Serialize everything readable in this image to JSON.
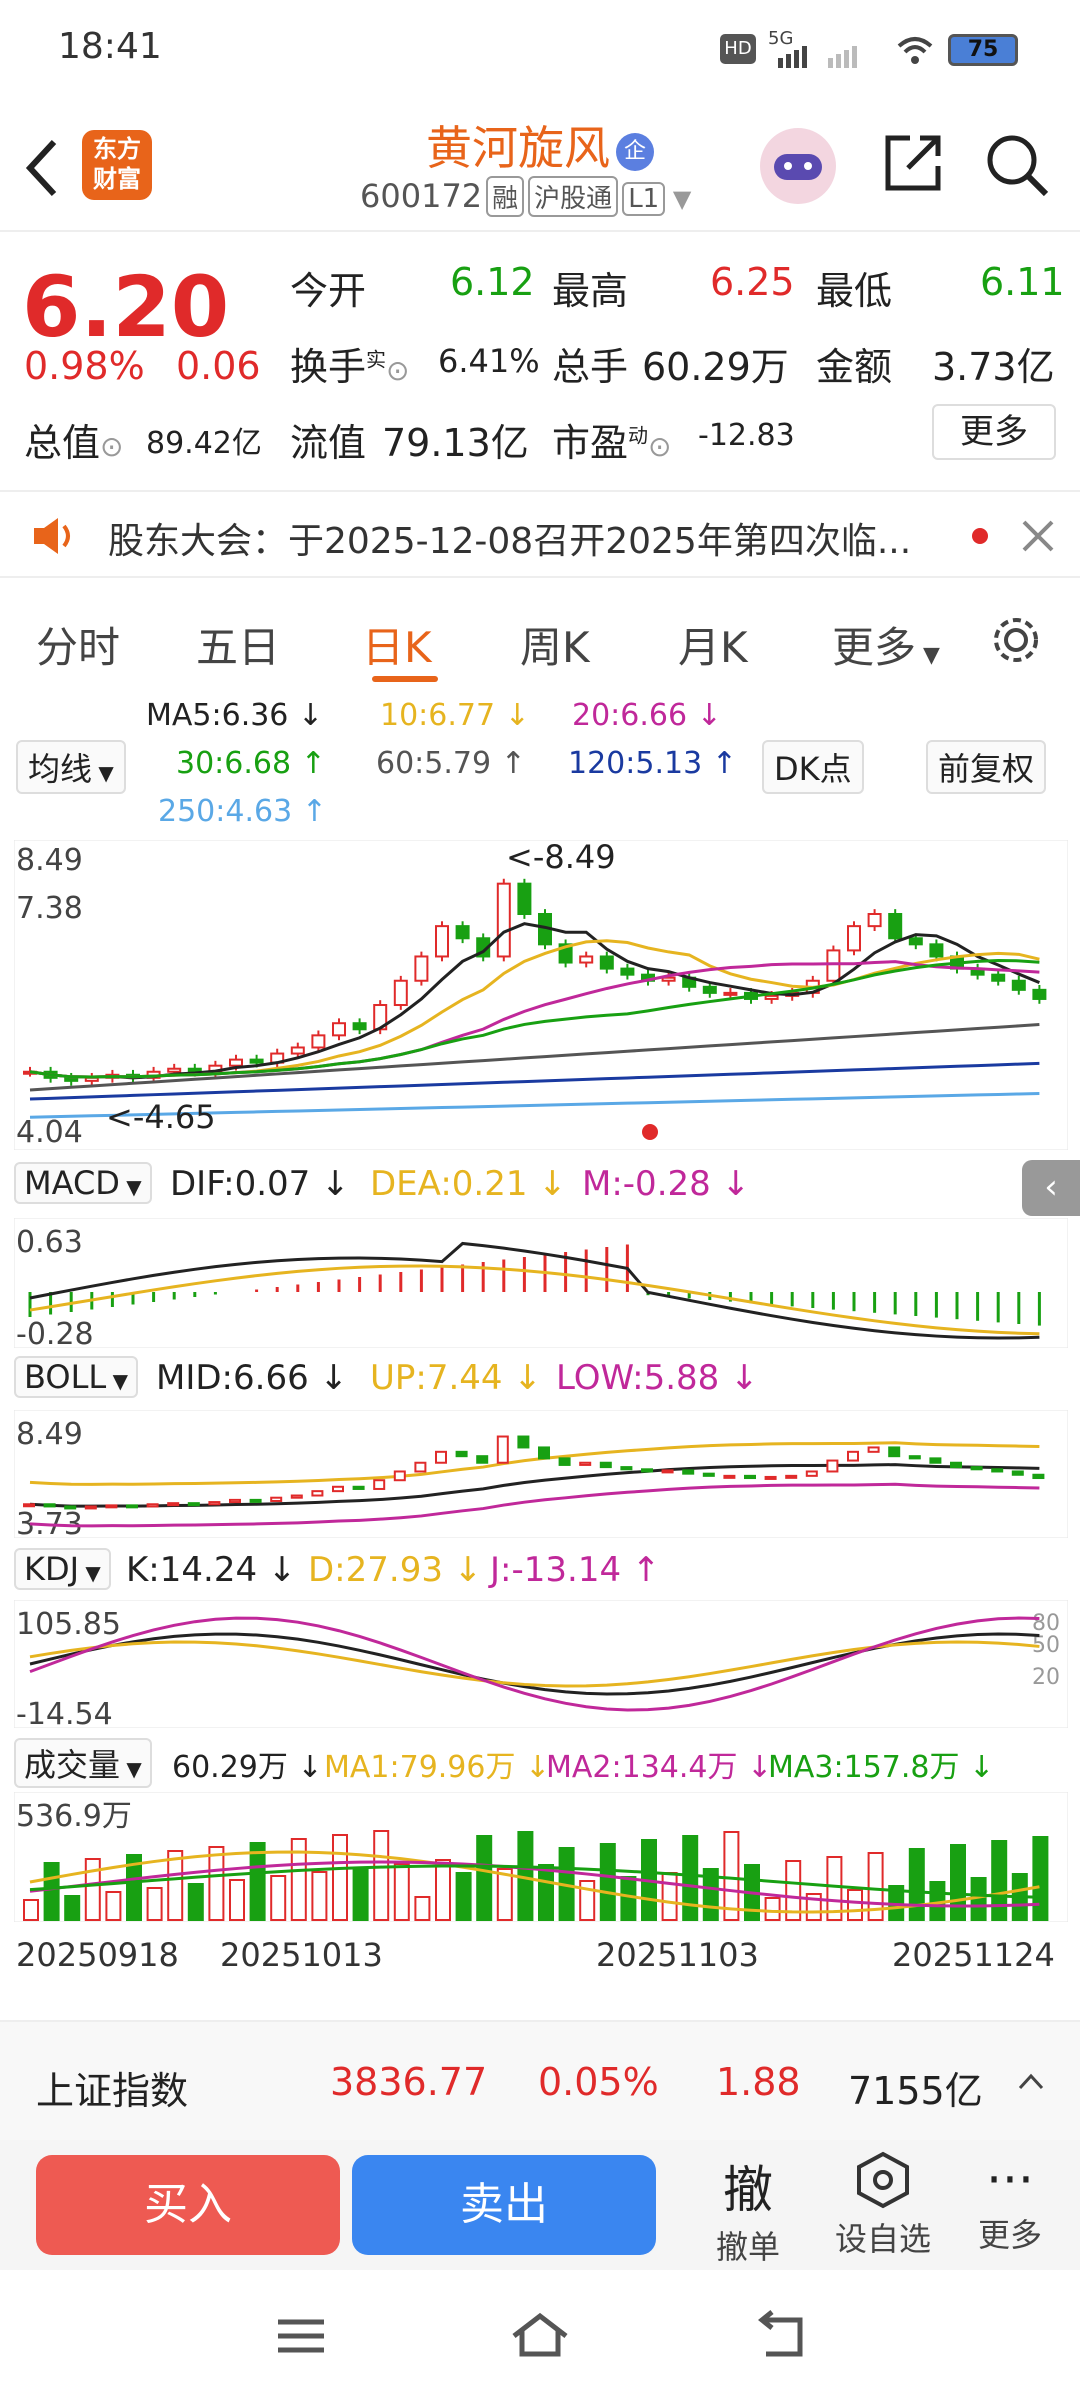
{
  "status": {
    "time": "18:41",
    "battery": "75",
    "network": "5G"
  },
  "header": {
    "back": "back",
    "logo_line1": "东方",
    "logo_line2": "财富",
    "name": "黄河旋风",
    "name_badge": "企",
    "code": "600172",
    "tags": [
      "融",
      "沪股通",
      "L1"
    ]
  },
  "quote": {
    "price": "6.20",
    "change_pct": "0.98%",
    "change": "0.06",
    "open_label": "今开",
    "open": "6.12",
    "high_label": "最高",
    "high": "6.25",
    "low_label": "最低",
    "low": "6.11",
    "turnover_label": "换手",
    "turnover_sup": "实",
    "turnover": "6.41%",
    "volume_label": "总手",
    "volume": "60.29万",
    "amount_label": "金额",
    "amount": "3.73亿",
    "mktcap_label": "总值",
    "mktcap": "89.42亿",
    "float_label": "流值",
    "float": "79.13亿",
    "pe_label": "市盈",
    "pe_sup": "动",
    "pe": "-12.83",
    "more": "更多"
  },
  "notice": {
    "text": "股东大会：于2025-12-08召开2025年第四次临..."
  },
  "tabs": [
    {
      "label": "分时"
    },
    {
      "label": "五日"
    },
    {
      "label": "日K"
    },
    {
      "label": "周K"
    },
    {
      "label": "月K"
    },
    {
      "label": "更多"
    }
  ],
  "ma": {
    "selector": "均线",
    "ma5": "MA5:6.36 ↓",
    "ma10": "10:6.77 ↓",
    "ma20": "20:6.66 ↓",
    "ma30": "30:6.68 ↑",
    "ma60": "60:5.79 ↑",
    "ma120": "120:5.13 ↑",
    "ma250": "250:4.63 ↑",
    "dk": "DK点",
    "adj": "前复权"
  },
  "kchart": {
    "ymax": "8.49",
    "y2": "7.38",
    "ymin": "4.04",
    "high_mark": "<-8.49",
    "low_mark": "<-4.65"
  },
  "macd": {
    "selector": "MACD",
    "dif": "DIF:0.07 ↓",
    "dea": "DEA:0.21 ↓",
    "m": "M:-0.28 ↓",
    "ymax": "0.63",
    "ymin": "-0.28"
  },
  "boll": {
    "selector": "BOLL",
    "mid": "MID:6.66 ↓",
    "up": "UP:7.44 ↓",
    "low": "LOW:5.88 ↓",
    "ymax": "8.49",
    "ymin": "3.73"
  },
  "kdj": {
    "selector": "KDJ",
    "k": "K:14.24 ↓",
    "d": "D:27.93 ↓",
    "j": "J:-13.14 ↑",
    "ymax": "105.85",
    "ymin": "-14.54",
    "l80": "80",
    "l50": "50",
    "l20": "20"
  },
  "vol": {
    "selector": "成交量",
    "vol": "60.29万 ↓",
    "ma1": "MA1:79.96万 ↓",
    "ma2": "MA2:134.4万 ↓",
    "ma3": "MA3:157.8万 ↓",
    "ymax": "536.9万"
  },
  "dates": [
    "20250918",
    "20251013",
    "20251103",
    "20251124"
  ],
  "index": {
    "name": "上证指数",
    "value": "3836.77",
    "pct": "0.05%",
    "change": "1.88",
    "amount": "7155亿"
  },
  "actions": {
    "buy": "买入",
    "sell": "卖出",
    "cancel": "撤单",
    "cancel_glyph": "撤",
    "watch": "设自选",
    "more": "更多"
  },
  "colors": {
    "up": "#e02a2a",
    "down": "#18a012",
    "accent": "#e8641a"
  }
}
